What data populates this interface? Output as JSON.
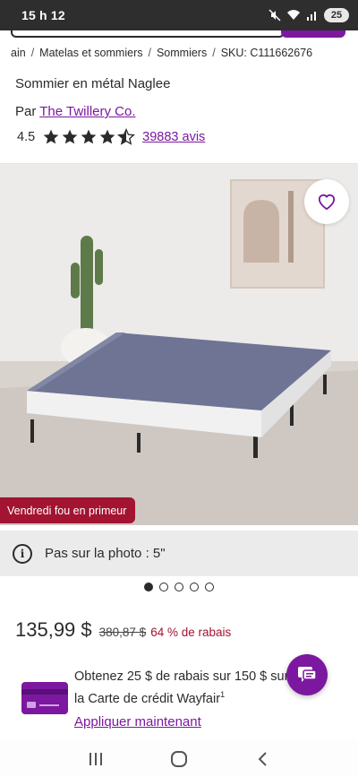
{
  "status_bar": {
    "time": "15 h 12",
    "battery": "25",
    "icons": [
      "mute-icon",
      "wifi-icon",
      "signal-icon",
      "battery-icon"
    ]
  },
  "breadcrumb": [
    "ain",
    "Matelas et sommiers",
    "Sommiers",
    "SKU: C111662676"
  ],
  "product": {
    "title": "Sommier en métal Naglee",
    "brand_prefix": "Par",
    "brand": "The Twillery Co.",
    "rating": "4.5",
    "rating_value": 4.5,
    "stars_max": 5,
    "reviews": "39883 avis"
  },
  "image": {
    "promo_badge": "Vendredi fou en primeur",
    "wishlist_icon": "heart-outline-icon"
  },
  "photo_note": {
    "icon": "info-icon",
    "icon_glyph": "i",
    "text": "Pas sur la photo : 5\""
  },
  "carousel": {
    "total": 5,
    "active": 0
  },
  "pricing": {
    "price": "135,99 $",
    "old_price": "380,87 $",
    "discount": "64 % de rabais"
  },
  "card_offer": {
    "text": "Obtenez 25 $ de rabais sur 150 $ sur",
    "text2": "la Carte de crédit Wayfair",
    "footnote": "1",
    "cta": "Appliquer maintenant"
  },
  "colors": {
    "brand_purple": "#7b189f",
    "sale_red": "#a21431",
    "status_bar": "#2e2e2e"
  },
  "nav": [
    "recents-icon",
    "home-icon",
    "back-icon"
  ]
}
